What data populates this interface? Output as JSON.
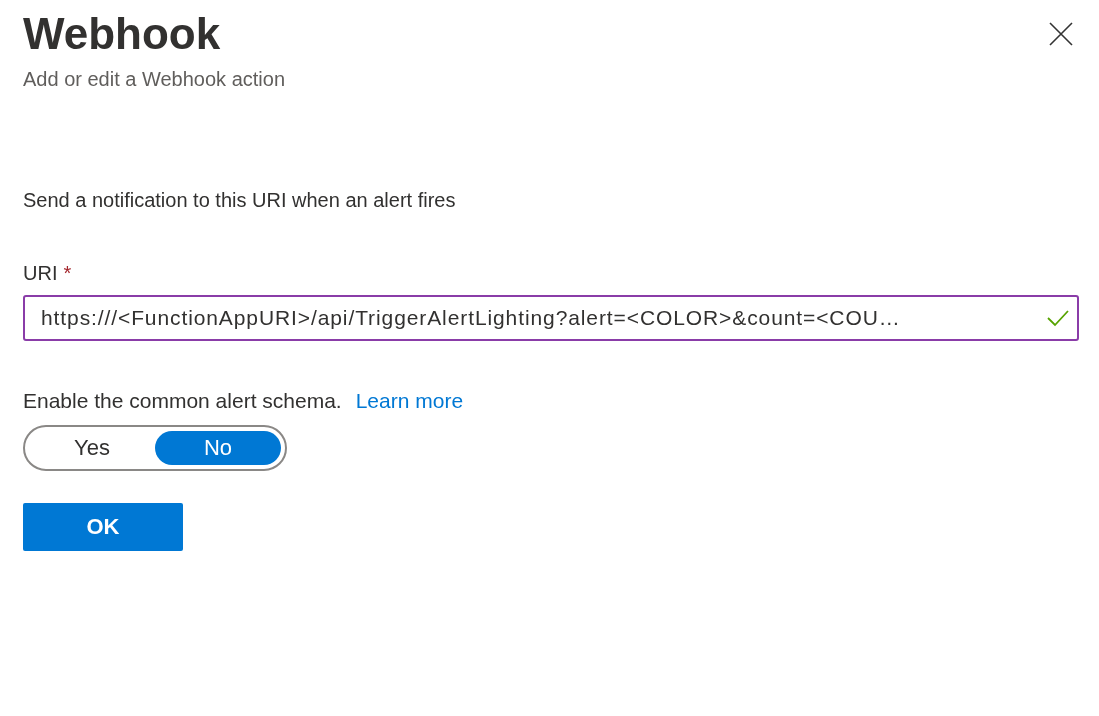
{
  "panel": {
    "title": "Webhook",
    "subtitle": "Add or edit a Webhook action"
  },
  "description": "Send a notification to this URI when an alert fires",
  "uri_field": {
    "label": "URI",
    "required_mark": "*",
    "value": "https:///<FunctionAppURI>/api/TriggerAlertLighting?alert=<COLOR>&count=<COU…",
    "valid": true
  },
  "schema": {
    "label": "Enable the common alert schema.",
    "link": "Learn more",
    "options": [
      {
        "label": "Yes",
        "selected": false
      },
      {
        "label": "No",
        "selected": true
      }
    ]
  },
  "buttons": [
    {
      "label": "OK",
      "kind": "primary"
    }
  ]
}
